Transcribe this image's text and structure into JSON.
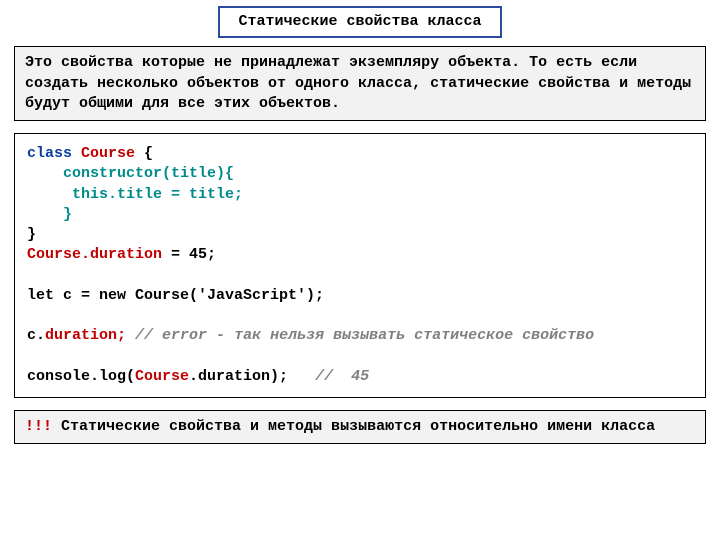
{
  "heading": "Статические свойства класса",
  "description": "Это свойства  которые не принадлежат экземпляру объекта.\nТо есть если создать несколько объектов  от одного класса, статические свойства и методы будут общими для все этих объектов.",
  "code": {
    "l1": {
      "kw": "class ",
      "cls": "Course ",
      "brace": "{"
    },
    "l2": {
      "fn": "    constructor(title){"
    },
    "l3": {
      "body": "     this.title = title;"
    },
    "l4": {
      "brace": "    }"
    },
    "l5": {
      "brace": "}"
    },
    "l6": {
      "ref": "Course.duration",
      "rest": " = 45;"
    },
    "blank1": "",
    "l7": {
      "txt": "let c = new Course('JavaScript');"
    },
    "blank2": "",
    "l8": {
      "obj": "c",
      "dot": ".",
      "prop": "duration;",
      "comment": " // error - так нельзя вызывать статическое свойство"
    },
    "blank3": "",
    "l9": {
      "pre": "console.log(",
      "cls": "Course",
      "post": ".duration);  ",
      "comment": " //  45"
    }
  },
  "footer": {
    "bang": "!!!",
    "text": " Статические свойства  и методы вызываются относительно имени класса"
  }
}
